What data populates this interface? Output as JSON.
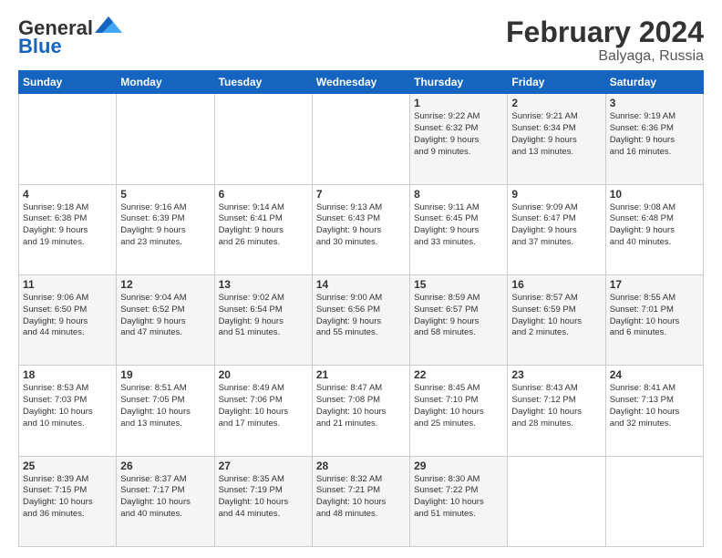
{
  "logo": {
    "line1": "General",
    "line2": "Blue"
  },
  "title": "February 2024",
  "subtitle": "Balyaga, Russia",
  "days_of_week": [
    "Sunday",
    "Monday",
    "Tuesday",
    "Wednesday",
    "Thursday",
    "Friday",
    "Saturday"
  ],
  "weeks": [
    [
      {
        "day": "",
        "data": ""
      },
      {
        "day": "",
        "data": ""
      },
      {
        "day": "",
        "data": ""
      },
      {
        "day": "",
        "data": ""
      },
      {
        "day": "1",
        "data": "Sunrise: 9:22 AM\nSunset: 6:32 PM\nDaylight: 9 hours\nand 9 minutes."
      },
      {
        "day": "2",
        "data": "Sunrise: 9:21 AM\nSunset: 6:34 PM\nDaylight: 9 hours\nand 13 minutes."
      },
      {
        "day": "3",
        "data": "Sunrise: 9:19 AM\nSunset: 6:36 PM\nDaylight: 9 hours\nand 16 minutes."
      }
    ],
    [
      {
        "day": "4",
        "data": "Sunrise: 9:18 AM\nSunset: 6:38 PM\nDaylight: 9 hours\nand 19 minutes."
      },
      {
        "day": "5",
        "data": "Sunrise: 9:16 AM\nSunset: 6:39 PM\nDaylight: 9 hours\nand 23 minutes."
      },
      {
        "day": "6",
        "data": "Sunrise: 9:14 AM\nSunset: 6:41 PM\nDaylight: 9 hours\nand 26 minutes."
      },
      {
        "day": "7",
        "data": "Sunrise: 9:13 AM\nSunset: 6:43 PM\nDaylight: 9 hours\nand 30 minutes."
      },
      {
        "day": "8",
        "data": "Sunrise: 9:11 AM\nSunset: 6:45 PM\nDaylight: 9 hours\nand 33 minutes."
      },
      {
        "day": "9",
        "data": "Sunrise: 9:09 AM\nSunset: 6:47 PM\nDaylight: 9 hours\nand 37 minutes."
      },
      {
        "day": "10",
        "data": "Sunrise: 9:08 AM\nSunset: 6:48 PM\nDaylight: 9 hours\nand 40 minutes."
      }
    ],
    [
      {
        "day": "11",
        "data": "Sunrise: 9:06 AM\nSunset: 6:50 PM\nDaylight: 9 hours\nand 44 minutes."
      },
      {
        "day": "12",
        "data": "Sunrise: 9:04 AM\nSunset: 6:52 PM\nDaylight: 9 hours\nand 47 minutes."
      },
      {
        "day": "13",
        "data": "Sunrise: 9:02 AM\nSunset: 6:54 PM\nDaylight: 9 hours\nand 51 minutes."
      },
      {
        "day": "14",
        "data": "Sunrise: 9:00 AM\nSunset: 6:56 PM\nDaylight: 9 hours\nand 55 minutes."
      },
      {
        "day": "15",
        "data": "Sunrise: 8:59 AM\nSunset: 6:57 PM\nDaylight: 9 hours\nand 58 minutes."
      },
      {
        "day": "16",
        "data": "Sunrise: 8:57 AM\nSunset: 6:59 PM\nDaylight: 10 hours\nand 2 minutes."
      },
      {
        "day": "17",
        "data": "Sunrise: 8:55 AM\nSunset: 7:01 PM\nDaylight: 10 hours\nand 6 minutes."
      }
    ],
    [
      {
        "day": "18",
        "data": "Sunrise: 8:53 AM\nSunset: 7:03 PM\nDaylight: 10 hours\nand 10 minutes."
      },
      {
        "day": "19",
        "data": "Sunrise: 8:51 AM\nSunset: 7:05 PM\nDaylight: 10 hours\nand 13 minutes."
      },
      {
        "day": "20",
        "data": "Sunrise: 8:49 AM\nSunset: 7:06 PM\nDaylight: 10 hours\nand 17 minutes."
      },
      {
        "day": "21",
        "data": "Sunrise: 8:47 AM\nSunset: 7:08 PM\nDaylight: 10 hours\nand 21 minutes."
      },
      {
        "day": "22",
        "data": "Sunrise: 8:45 AM\nSunset: 7:10 PM\nDaylight: 10 hours\nand 25 minutes."
      },
      {
        "day": "23",
        "data": "Sunrise: 8:43 AM\nSunset: 7:12 PM\nDaylight: 10 hours\nand 28 minutes."
      },
      {
        "day": "24",
        "data": "Sunrise: 8:41 AM\nSunset: 7:13 PM\nDaylight: 10 hours\nand 32 minutes."
      }
    ],
    [
      {
        "day": "25",
        "data": "Sunrise: 8:39 AM\nSunset: 7:15 PM\nDaylight: 10 hours\nand 36 minutes."
      },
      {
        "day": "26",
        "data": "Sunrise: 8:37 AM\nSunset: 7:17 PM\nDaylight: 10 hours\nand 40 minutes."
      },
      {
        "day": "27",
        "data": "Sunrise: 8:35 AM\nSunset: 7:19 PM\nDaylight: 10 hours\nand 44 minutes."
      },
      {
        "day": "28",
        "data": "Sunrise: 8:32 AM\nSunset: 7:21 PM\nDaylight: 10 hours\nand 48 minutes."
      },
      {
        "day": "29",
        "data": "Sunrise: 8:30 AM\nSunset: 7:22 PM\nDaylight: 10 hours\nand 51 minutes."
      },
      {
        "day": "",
        "data": ""
      },
      {
        "day": "",
        "data": ""
      }
    ]
  ]
}
